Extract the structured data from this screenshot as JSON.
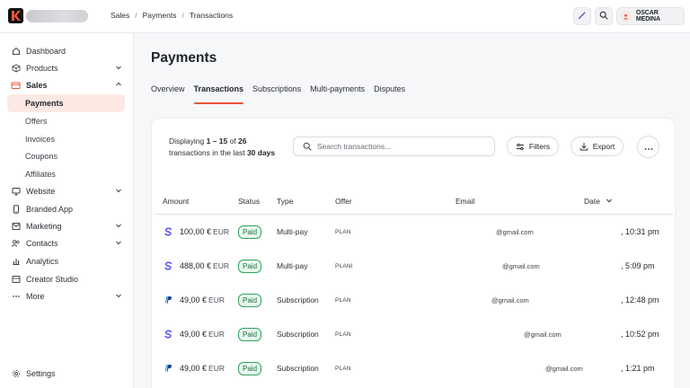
{
  "topbar": {
    "breadcrumbs": [
      "Sales",
      "Payments",
      "Transactions"
    ],
    "user_name": "OSCAR MEDINA"
  },
  "sidebar": {
    "items": [
      {
        "label": "Dashboard",
        "icon": "home-icon"
      },
      {
        "label": "Products",
        "icon": "cube-icon"
      },
      {
        "label": "Sales",
        "icon": "credit-card-icon"
      },
      {
        "label": "Website",
        "icon": "monitor-icon"
      },
      {
        "label": "Branded App",
        "icon": "phone-icon"
      },
      {
        "label": "Marketing",
        "icon": "megaphone-icon"
      },
      {
        "label": "Contacts",
        "icon": "users-icon"
      },
      {
        "label": "Analytics",
        "icon": "chart-icon"
      },
      {
        "label": "Creator Studio",
        "icon": "studio-icon"
      },
      {
        "label": "More",
        "icon": "dots-icon"
      },
      {
        "label": "Settings",
        "icon": "gear-icon"
      }
    ],
    "sales_sub": [
      "Payments",
      "Offers",
      "Invoices",
      "Coupons",
      "Affiliates"
    ]
  },
  "page": {
    "title": "Payments",
    "tabs": [
      "Overview",
      "Transactions",
      "Subscriptions",
      "Multi-payments",
      "Disputes"
    ],
    "active_tab": "Transactions"
  },
  "toolbar": {
    "display_pre": "Displaying ",
    "display_range": "1 – 15",
    "display_of": " of ",
    "display_total": "26",
    "display_mid": "transactions in the last ",
    "display_period": "30 days",
    "search_placeholder": "Search transactions...",
    "filters_label": "Filters",
    "export_label": "Export"
  },
  "table": {
    "columns": {
      "amount": "Amount",
      "status": "Status",
      "type": "Type",
      "offer": "Offer",
      "email": "Email",
      "date": "Date"
    },
    "rows": [
      {
        "method": "stripe",
        "amount": "100,00 €",
        "currency": "EUR",
        "status": "Paid",
        "type": "Multi-pay",
        "offer": "PLAN",
        "email": "@gmail.com",
        "date": ", 10:31 pm"
      },
      {
        "method": "stripe",
        "amount": "488,00 €",
        "currency": "EUR",
        "status": "Paid",
        "type": "Multi-pay",
        "offer": "PLANI",
        "email": "@gmail.com",
        "date": ", 5:09 pm"
      },
      {
        "method": "paypal",
        "amount": "49,00 €",
        "currency": "EUR",
        "status": "Paid",
        "type": "Subscription",
        "offer": "PLAN",
        "email": "@gmail.com",
        "date": ", 12:48 pm"
      },
      {
        "method": "stripe",
        "amount": "49,00 €",
        "currency": "EUR",
        "status": "Paid",
        "type": "Subscription",
        "offer": "PLAN",
        "email": "@gmail.com",
        "date": ", 10:52 pm"
      },
      {
        "method": "paypal",
        "amount": "49,00 €",
        "currency": "EUR",
        "status": "Paid",
        "type": "Subscription",
        "offer": "PLAN",
        "email": "@gmail.com",
        "date": ", 1:21 pm"
      }
    ]
  },
  "colors": {
    "accent": "#e8543a",
    "stripe": "#635bff",
    "paypal": "#1f3a8a",
    "paid_border": "#2fa45f"
  }
}
